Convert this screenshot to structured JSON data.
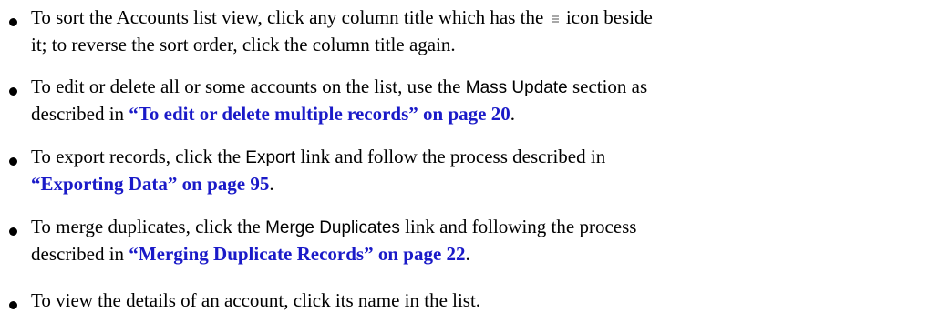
{
  "bullets": {
    "sort": {
      "line1_a": "To sort the Accounts list view, click any column title which has the ",
      "icon": "sort-icon",
      "line1_b": " icon beside",
      "line2": "it; to reverse the sort order, click the column title again."
    },
    "mass_update": {
      "line1_a": "To edit or delete all or some accounts on the list, use the ",
      "ui_term": "Mass Update",
      "line1_b": " section as",
      "line2_a": "described in ",
      "link": "“To edit or delete multiple records” on page 20",
      "line2_b": "."
    },
    "export": {
      "line1_a": "To export records, click the ",
      "ui_term": "Export",
      "line1_b": " link and follow the process described in",
      "link": "“Exporting Data” on page 95",
      "line2_b": "."
    },
    "merge": {
      "line1_a": "To merge duplicates, click the ",
      "ui_term": "Merge Duplicates",
      "line1_b": " link and following the process",
      "line2_a": "described in ",
      "link": "“Merging Duplicate Records” on page 22",
      "line2_b": "."
    },
    "view": {
      "line1": "To view the details of an account, click its name in the list."
    }
  },
  "colors": {
    "text": "#000000",
    "link": "#1a1ac8",
    "sort_icon": "#a8a8a8"
  }
}
